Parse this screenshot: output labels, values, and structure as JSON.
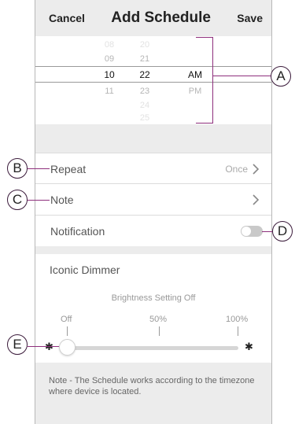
{
  "header": {
    "cancel_label": "Cancel",
    "title": "Add Schedule",
    "save_label": "Save"
  },
  "time_picker": {
    "hours": [
      "08",
      "09",
      "10",
      "11"
    ],
    "minutes": [
      "20",
      "21",
      "22",
      "23",
      "24",
      "25"
    ],
    "periods": [
      "AM",
      "PM"
    ],
    "selected": {
      "hour": "10",
      "minute": "22",
      "period": "AM"
    }
  },
  "rows": {
    "repeat": {
      "label": "Repeat",
      "value": "Once"
    },
    "note": {
      "label": "Note"
    },
    "notification": {
      "label": "Notification",
      "enabled": false
    }
  },
  "dimmer": {
    "title": "Iconic Dimmer",
    "subtitle": "Brightness Setting Off",
    "ticks": [
      "Off",
      "50%",
      "100%"
    ],
    "level": 0
  },
  "footer_note": "Note - The Schedule works according to the timezone where device is located.",
  "callouts": [
    "A",
    "B",
    "C",
    "D",
    "E"
  ],
  "colors": {
    "accent_line": "#8e2f7c",
    "section_bg": "#ececec"
  }
}
